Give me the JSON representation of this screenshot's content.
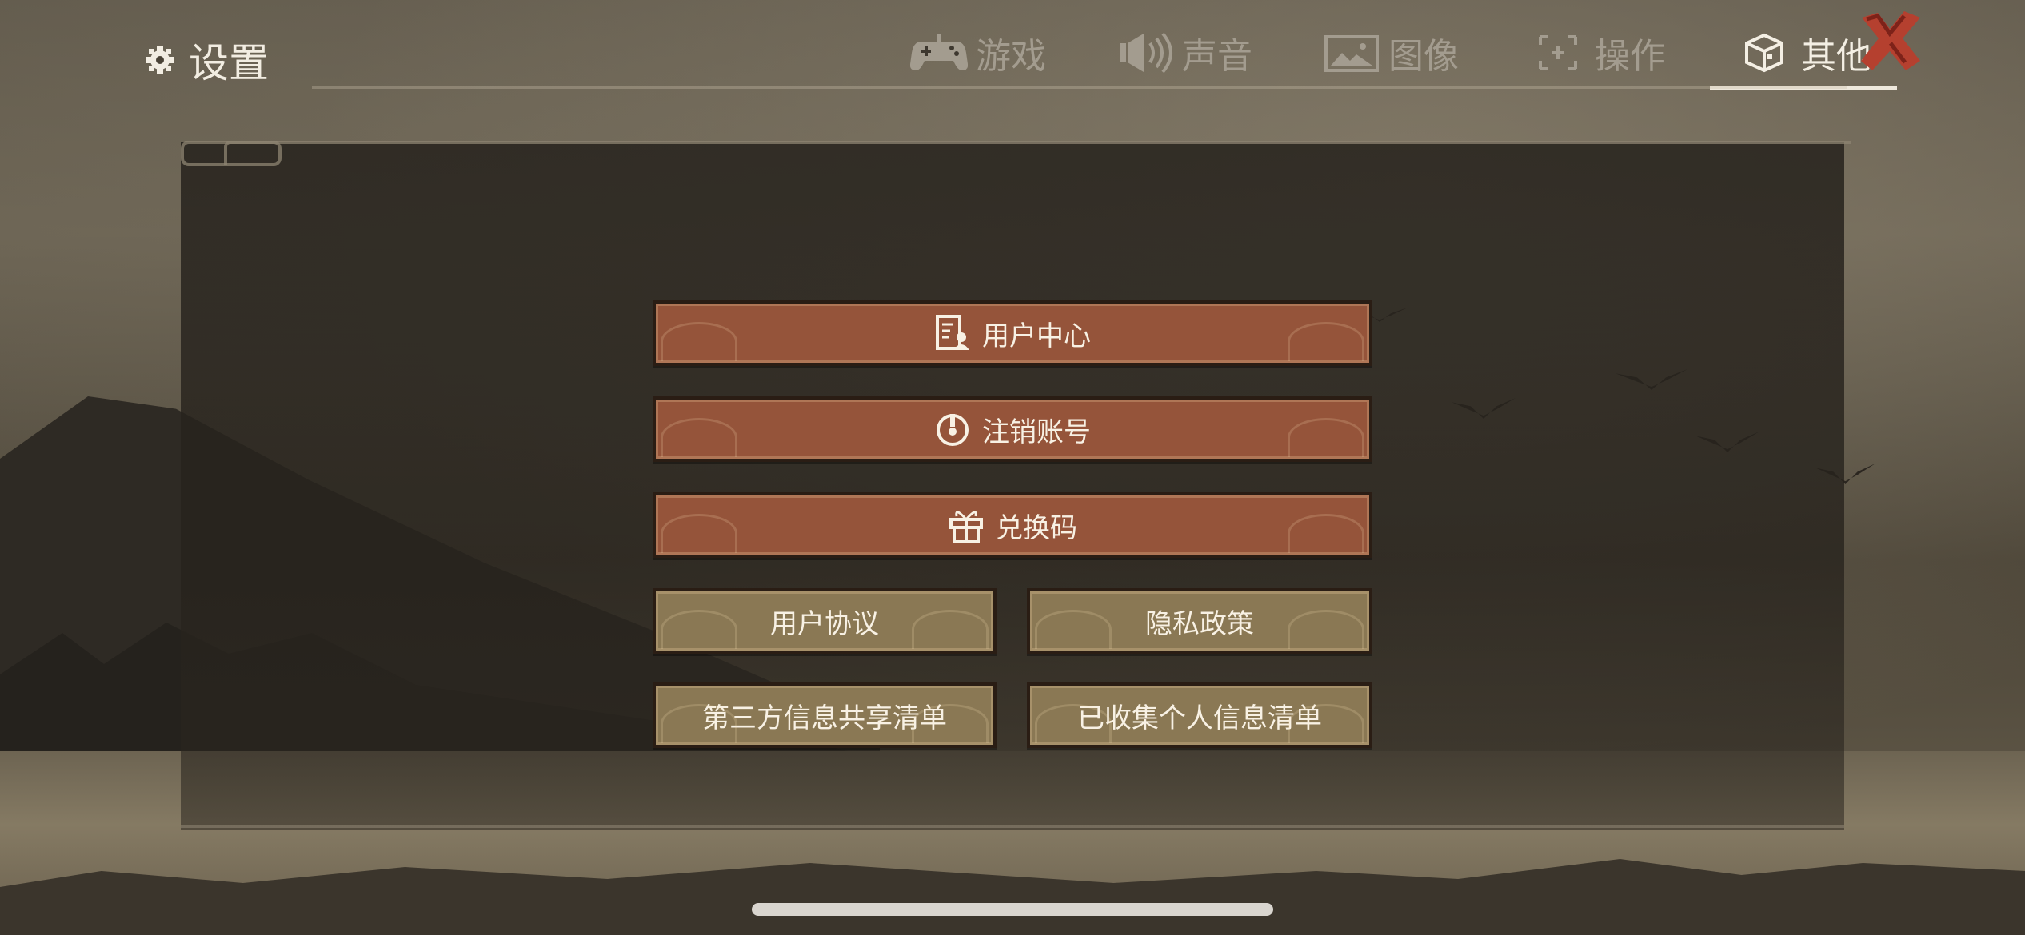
{
  "header": {
    "title": "设置",
    "title_icon": "gear-icon",
    "tabs": [
      {
        "label": "游戏",
        "icon": "gamepad-icon",
        "active": false
      },
      {
        "label": "声音",
        "icon": "speaker-icon",
        "active": false
      },
      {
        "label": "图像",
        "icon": "image-icon",
        "active": false
      },
      {
        "label": "操作",
        "icon": "crosshair-icon",
        "active": false
      },
      {
        "label": "其他",
        "icon": "cube-icon",
        "active": true
      }
    ],
    "close_icon": "close-icon"
  },
  "menu": {
    "user_center": {
      "label": "用户中心",
      "icon": "user-profile-icon"
    },
    "delete_account": {
      "label": "注销账号",
      "icon": "power-icon"
    },
    "redeem_code": {
      "label": "兑换码",
      "icon": "gift-icon"
    },
    "user_agreement": {
      "label": "用户协议"
    },
    "privacy_policy": {
      "label": "隐私政策"
    },
    "third_party_list": {
      "label": "第三方信息共享清单"
    },
    "collected_info_list": {
      "label": "已收集个人信息清单"
    }
  },
  "colors": {
    "primary_button": "#95543a",
    "secondary_button": "#8a7854",
    "active_tab": "#f4efe4",
    "inactive_tab": "#a39c8f"
  }
}
